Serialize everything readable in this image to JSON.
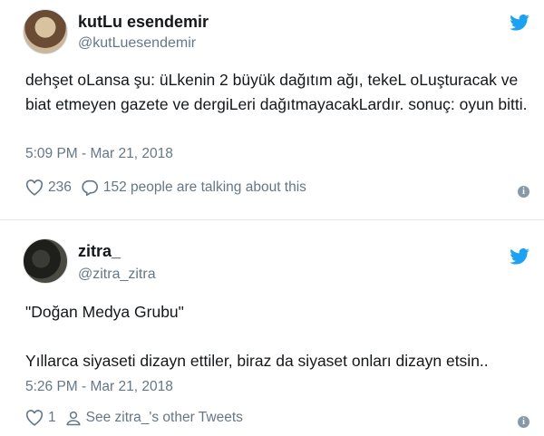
{
  "tweets": [
    {
      "name": "kutLu esendemir",
      "handle": "@kutLuesendemir",
      "text": "dehşet oLansa şu: üLkenin 2 büyük dağıtım ağı, tekeL oLuşturacak ve biat etmeyen gazete ve dergiLeri dağıtmayacakLardır. sonuç: oyun bitti.",
      "timestamp": "5:09 PM - Mar 21, 2018",
      "likes": "236",
      "replies_label": "152 people are talking about this",
      "brand_color": "#1da1f2"
    },
    {
      "name": "zitra_",
      "handle": "@zitra_zitra",
      "text_line1": "\"Doğan Medya Grubu\"",
      "text_line2": "Yıllarca siyaseti dizayn ettiler, biraz da siyaset onları dizayn etsin..",
      "timestamp": "5:26 PM - Mar 21, 2018",
      "likes": "1",
      "profile_label": "See zitra_'s other Tweets",
      "brand_color": "#1da1f2"
    }
  ]
}
